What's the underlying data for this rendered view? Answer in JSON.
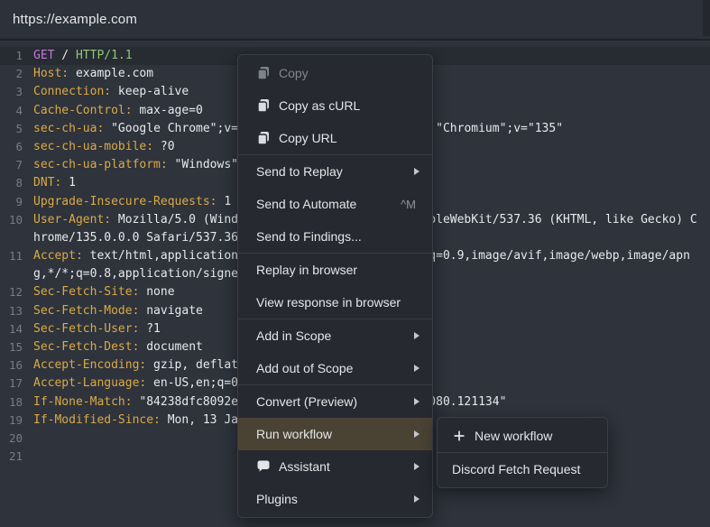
{
  "url_bar": {
    "url": "https://example.com"
  },
  "colors": {
    "editor_bg": "#2e333c",
    "topbar_bg": "#2d313a",
    "menu_bg": "#26292f",
    "highlight_bg": "#4a4334",
    "header_name": "#dcaa43",
    "method": "#c07ad6",
    "http_version": "#8ec973"
  },
  "editor": {
    "rows": [
      {
        "num": "1",
        "active": true,
        "parts": [
          {
            "c": "method",
            "t": "GET"
          },
          {
            "c": "plain",
            "t": " / "
          },
          {
            "c": "version",
            "t": "HTTP/1.1"
          }
        ]
      },
      {
        "num": "2",
        "parts": [
          {
            "c": "name",
            "t": "Host:"
          },
          {
            "c": "plain",
            "t": " example.com"
          }
        ]
      },
      {
        "num": "3",
        "parts": [
          {
            "c": "name",
            "t": "Connection:"
          },
          {
            "c": "plain",
            "t": " keep-alive"
          }
        ]
      },
      {
        "num": "4",
        "parts": [
          {
            "c": "name",
            "t": "Cache-Control:"
          },
          {
            "c": "plain",
            "t": " max-age=0"
          }
        ]
      },
      {
        "num": "5",
        "parts": [
          {
            "c": "name",
            "t": "sec-ch-ua:"
          },
          {
            "c": "plain",
            "t": " \"Google Chrome\";v=\"135\", \"Not-A.Brand\";v=\"8\", \"Chromium\";v=\"135\""
          }
        ]
      },
      {
        "num": "6",
        "parts": [
          {
            "c": "name",
            "t": "sec-ch-ua-mobile:"
          },
          {
            "c": "plain",
            "t": " ?0"
          }
        ]
      },
      {
        "num": "7",
        "parts": [
          {
            "c": "name",
            "t": "sec-ch-ua-platform:"
          },
          {
            "c": "plain",
            "t": " \"Windows\""
          }
        ]
      },
      {
        "num": "8",
        "parts": [
          {
            "c": "name",
            "t": "DNT:"
          },
          {
            "c": "plain",
            "t": " 1"
          }
        ]
      },
      {
        "num": "9",
        "parts": [
          {
            "c": "name",
            "t": "Upgrade-Insecure-Requests:"
          },
          {
            "c": "plain",
            "t": " 1"
          }
        ]
      },
      {
        "num": "10",
        "parts": [
          {
            "c": "name",
            "t": "User-Agent:"
          },
          {
            "c": "plain",
            "t": " Mozilla/5.0 (Windows NT 10.0; Win64; x64) AppleWebKit/537.36 (KHTML, like Gecko) C"
          }
        ]
      },
      {
        "num": "",
        "parts": [
          {
            "c": "plain",
            "t": "hrome/135.0.0.0 Safari/537.36"
          }
        ]
      },
      {
        "num": "11",
        "parts": [
          {
            "c": "name",
            "t": "Accept:"
          },
          {
            "c": "plain",
            "t": " text/html,application/xhtml+xml,application/xml;q=0.9,image/avif,image/webp,image/apn"
          }
        ]
      },
      {
        "num": "",
        "parts": [
          {
            "c": "plain",
            "t": "g,*/*;q=0.8,application/signed-exchange;v=b3;q=0.7"
          }
        ]
      },
      {
        "num": "12",
        "parts": [
          {
            "c": "name",
            "t": "Sec-Fetch-Site:"
          },
          {
            "c": "plain",
            "t": " none"
          }
        ]
      },
      {
        "num": "13",
        "parts": [
          {
            "c": "name",
            "t": "Sec-Fetch-Mode:"
          },
          {
            "c": "plain",
            "t": " navigate"
          }
        ]
      },
      {
        "num": "14",
        "parts": [
          {
            "c": "name",
            "t": "Sec-Fetch-User:"
          },
          {
            "c": "plain",
            "t": " ?1"
          }
        ]
      },
      {
        "num": "15",
        "parts": [
          {
            "c": "name",
            "t": "Sec-Fetch-Dest:"
          },
          {
            "c": "plain",
            "t": " document"
          }
        ]
      },
      {
        "num": "16",
        "parts": [
          {
            "c": "name",
            "t": "Accept-Encoding:"
          },
          {
            "c": "plain",
            "t": " gzip, deflate, br, zstd"
          }
        ]
      },
      {
        "num": "17",
        "parts": [
          {
            "c": "name",
            "t": "Accept-Language:"
          },
          {
            "c": "plain",
            "t": " en-US,en;q=0.9"
          }
        ]
      },
      {
        "num": "18",
        "parts": [
          {
            "c": "name",
            "t": "If-None-Match:"
          },
          {
            "c": "plain",
            "t": " \"84238dfc8092e5d9c0dac8ef93371a07:1736799080.121134\""
          }
        ]
      },
      {
        "num": "19",
        "parts": [
          {
            "c": "name",
            "t": "If-Modified-Since:"
          },
          {
            "c": "plain",
            "t": " Mon, 13 Jan 2025 20:11:20 GMT"
          }
        ]
      },
      {
        "num": "20",
        "parts": []
      },
      {
        "num": "21",
        "parts": []
      }
    ]
  },
  "context_menu": {
    "items": [
      {
        "label": "Copy",
        "icon": "copy",
        "disabled": true
      },
      {
        "label": "Copy as cURL",
        "icon": "copy"
      },
      {
        "label": "Copy URL",
        "icon": "copy"
      },
      {
        "sep": true
      },
      {
        "label": "Send to Replay",
        "submenu": true
      },
      {
        "label": "Send to Automate",
        "shortcut": "^M"
      },
      {
        "label": "Send to Findings..."
      },
      {
        "sep": true
      },
      {
        "label": "Replay in browser"
      },
      {
        "label": "View response in browser"
      },
      {
        "sep": true
      },
      {
        "label": "Add in Scope",
        "submenu": true
      },
      {
        "label": "Add out of Scope",
        "submenu": true
      },
      {
        "sep": true
      },
      {
        "label": "Convert (Preview)",
        "submenu": true
      },
      {
        "label": "Run workflow",
        "submenu": true,
        "highlighted": true
      },
      {
        "label": "Assistant",
        "icon": "chat",
        "submenu": true
      },
      {
        "label": "Plugins",
        "submenu": true
      }
    ]
  },
  "workflow_submenu": {
    "items": [
      {
        "label": "New workflow",
        "icon": "plus"
      },
      {
        "sep": true
      },
      {
        "label": "Discord Fetch Request"
      }
    ]
  }
}
